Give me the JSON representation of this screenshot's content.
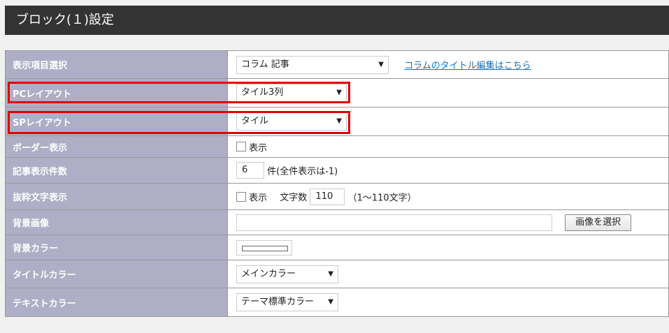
{
  "header": {
    "title": "ブロック(１)設定"
  },
  "rows": {
    "display_item": {
      "label": "表示項目選択",
      "value": "コラム 記事",
      "link": "コラムのタイトル編集はこちら"
    },
    "pc_layout": {
      "label": "PCレイアウト",
      "value": "タイル3列"
    },
    "sp_layout": {
      "label": "SPレイアウト",
      "value": "タイル"
    },
    "border": {
      "label": "ボーダー表示",
      "checkbox_label": "表示"
    },
    "count": {
      "label": "記事表示件数",
      "value": "6",
      "suffix": "件(全件表示は-1)"
    },
    "excerpt": {
      "label": "抜粋文字表示",
      "checkbox_label": "表示",
      "chars_label": "文字数",
      "chars_value": "110",
      "chars_hint": "（1〜110文字）"
    },
    "bg_image": {
      "label": "背景画像",
      "button": "画像を選択",
      "value": ""
    },
    "bg_color": {
      "label": "背景カラー"
    },
    "title_color": {
      "label": "タイトルカラー",
      "value": "メインカラー"
    },
    "text_color": {
      "label": "テキストカラー",
      "value": "テーマ標準カラー"
    }
  },
  "icons": {
    "dropdown": "▼"
  },
  "colors": {
    "header_bg": "#333333",
    "label_bg": "#aeaec6",
    "highlight": "#e00000",
    "link": "#1a6fb5"
  }
}
